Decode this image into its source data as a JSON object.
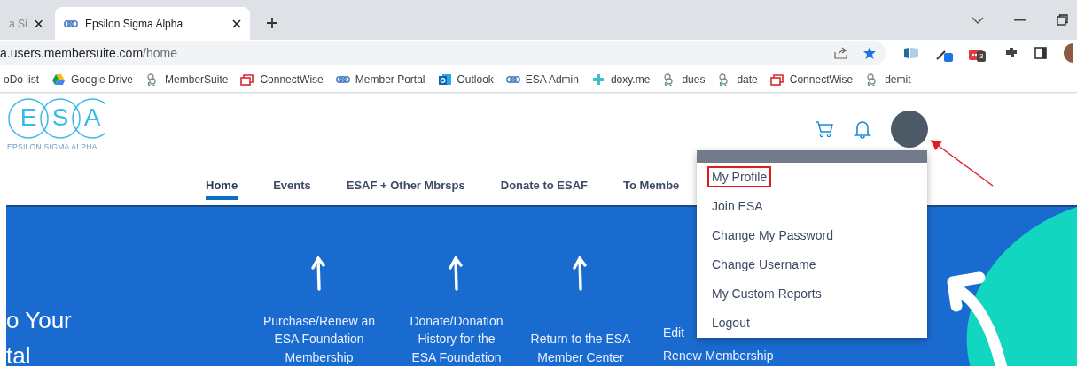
{
  "browser": {
    "tabs": [
      {
        "title": "a Si",
        "selected": false
      },
      {
        "title": "Epsilon Sigma Alpha",
        "selected": true
      }
    ],
    "address": {
      "host": "a.users.membersuite.com",
      "path": "/home"
    },
    "bookmarks": [
      {
        "label": "oDo list",
        "kind": "none"
      },
      {
        "label": "Google Drive",
        "kind": "drive"
      },
      {
        "label": "MemberSuite",
        "kind": "ms"
      },
      {
        "label": "ConnectWise",
        "kind": "cw"
      },
      {
        "label": "Member Portal",
        "kind": "esa"
      },
      {
        "label": "Outlook",
        "kind": "outlook"
      },
      {
        "label": "ESA Admin",
        "kind": "esa"
      },
      {
        "label": "doxy.me",
        "kind": "doxy"
      },
      {
        "label": "dues",
        "kind": "ms"
      },
      {
        "label": "date",
        "kind": "ms"
      },
      {
        "label": "ConnectWise",
        "kind": "cw"
      },
      {
        "label": "demit",
        "kind": "ms"
      }
    ],
    "extension_badge": "3"
  },
  "site": {
    "logo_letters": [
      "E",
      "S",
      "A"
    ],
    "logo_caption": "EPSILON SIGMA ALPHA",
    "nav": [
      {
        "label": "Home",
        "selected": true
      },
      {
        "label": "Events",
        "selected": false
      },
      {
        "label": "ESAF + Other Mbrsps",
        "selected": false
      },
      {
        "label": "Donate to ESAF",
        "selected": false
      },
      {
        "label": "To Membe",
        "selected": false
      }
    ],
    "hero": {
      "title_lines": [
        "o Your",
        "tal"
      ],
      "cards": [
        {
          "lines": [
            "Purchase/Renew an",
            "ESA Foundation",
            "Membership"
          ],
          "arrow": true
        },
        {
          "lines": [
            "Donate/Donation",
            "History for the",
            "ESA Foundation"
          ],
          "arrow": true
        },
        {
          "lines": [
            "Return to the ESA",
            "Member Center"
          ],
          "arrow": true
        },
        {
          "lines": [
            "Edit",
            "Renew Membership"
          ],
          "arrow": false
        }
      ]
    },
    "user_menu": [
      {
        "label": "My Profile",
        "highlighted": true
      },
      {
        "label": "Join ESA",
        "highlighted": false
      },
      {
        "label": "Change My Password",
        "highlighted": false
      },
      {
        "label": "Change Username",
        "highlighted": false
      },
      {
        "label": "My Custom Reports",
        "highlighted": false
      },
      {
        "label": "Logout",
        "highlighted": false
      }
    ]
  }
}
